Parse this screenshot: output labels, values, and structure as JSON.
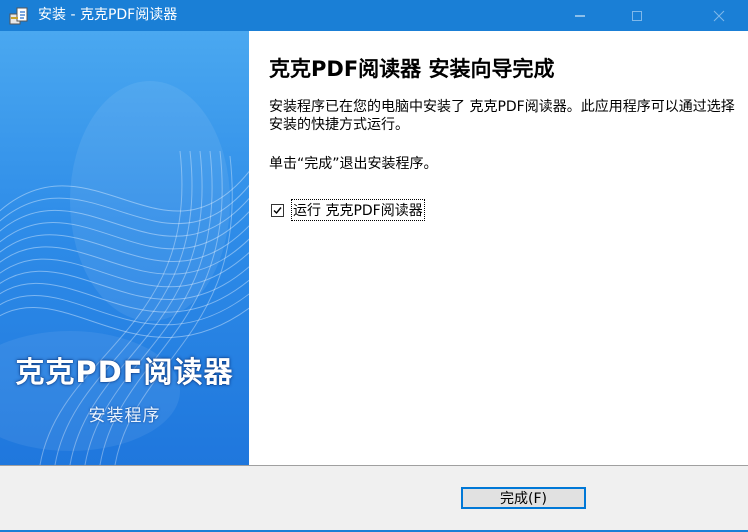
{
  "window": {
    "title": "安装 - 克克PDF阅读器",
    "title_color": "#1a7fd6"
  },
  "sidebar": {
    "brand_title": "克克PDF阅读器",
    "brand_subtitle": "安装程序",
    "background_color": "#2e8ce8"
  },
  "content": {
    "heading": "克克PDF阅读器 安装向导完成",
    "description": "安装程序已在您的电脑中安装了 克克PDF阅读器。此应用程序可以通过选择安装的快捷方式运行。",
    "exit_note": "单击“完成”退出安装程序。",
    "run_checkbox": {
      "label": "运行 克克PDF阅读器",
      "checked": true
    }
  },
  "footer": {
    "finish_button": "完成(F)",
    "accent_color": "#0078d7"
  }
}
